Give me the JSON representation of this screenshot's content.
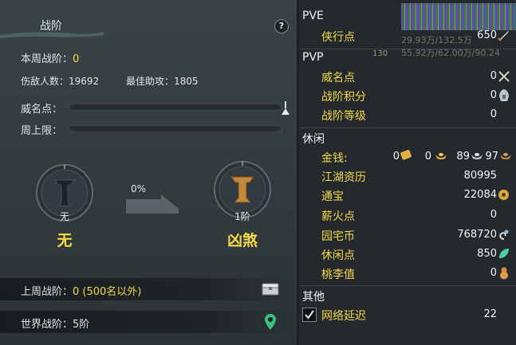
{
  "left": {
    "title": "战阶",
    "help_label": "?",
    "weekly_rank_label": "本周战阶：",
    "weekly_rank_value": "0",
    "kills_label": "伤敌人数：",
    "kills_value": "19692",
    "assist_label": "最佳助攻：",
    "assist_value": "1805",
    "prestige_label": "威名点：",
    "prestige_fill": 0,
    "weekly_cap_label": "周上限：",
    "weekly_cap_fill": 0,
    "progress_text": "0%",
    "current_rank_emblem_text": "无",
    "current_rank_name": "无",
    "next_rank_emblem_text": "1阶",
    "next_rank_name": "凶煞",
    "last_week_label": "上周战阶：",
    "last_week_value": "0 (500名以外)",
    "world_rank_label": "世界战阶：",
    "world_rank_value": "5阶"
  },
  "right": {
    "pve_head": "PVE",
    "pve_rows": [
      {
        "label": "侠行点",
        "value": "650",
        "icon": "sword-icon"
      }
    ],
    "pvp_head": "PVP",
    "pvp_rows": [
      {
        "label": "威名点",
        "value": "0",
        "icon": "crossed-swords-icon"
      },
      {
        "label": "战阶积分",
        "value": "0",
        "icon": "helmet-icon"
      },
      {
        "label": "战阶等级",
        "value": "0"
      }
    ],
    "leisure_head": "休闲",
    "money_label": "金钱:",
    "money_gold": "0",
    "money_silver": "0",
    "money_copper": "89",
    "money_extra": "97",
    "leisure_rows": [
      {
        "label": "江湖资历",
        "value": "80995"
      },
      {
        "label": "通宝",
        "value": "22084",
        "icon": "coin-icon"
      },
      {
        "label": "薪火点",
        "value": "0"
      },
      {
        "label": "园宅币",
        "value": "768720",
        "icon": "swirl-icon"
      },
      {
        "label": "休闲点",
        "value": "850",
        "icon": "leaf-icon"
      },
      {
        "label": "桃李值",
        "value": "0",
        "icon": "gourd-icon"
      }
    ],
    "other_head": "其他",
    "latency_label": "网络延迟",
    "latency_value": "22",
    "bg_text": [
      "29.93万/132.5万",
      "55.92万/62.00万/90.24",
      "130"
    ]
  },
  "colors": {
    "accent_yellow": "#f2d84a",
    "panel_bg": "#353d41",
    "right_bg": "#23292d",
    "bronze": "#c08a3a",
    "location_green": "#3bbf7a"
  }
}
